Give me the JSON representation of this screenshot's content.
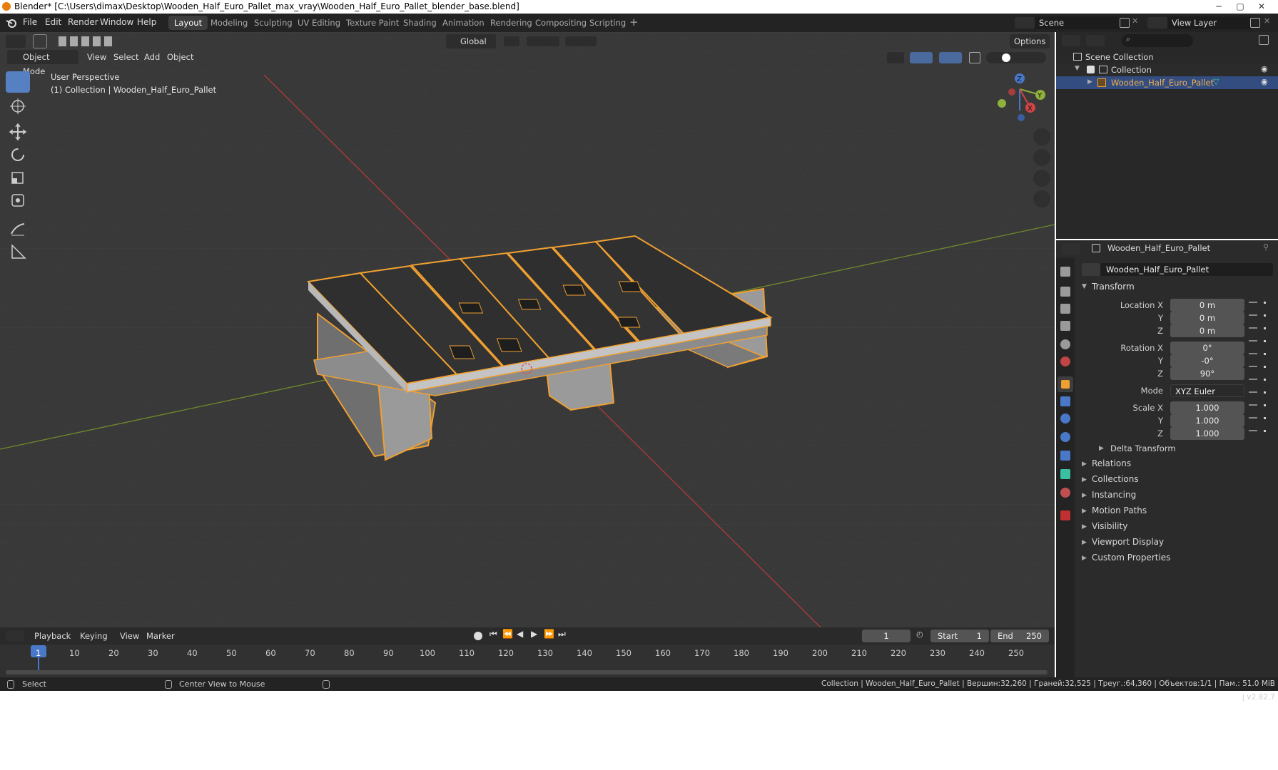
{
  "window": {
    "title": "Blender* [C:\\Users\\dimax\\Desktop\\Wooden_Half_Euro_Pallet_max_vray\\Wooden_Half_Euro_Pallet_blender_base.blend]",
    "min": "─",
    "max": "▢",
    "close": "✕"
  },
  "menu": [
    "File",
    "Edit",
    "Render",
    "Window",
    "Help"
  ],
  "workspaces": [
    "Layout",
    "Modeling",
    "Sculpting",
    "UV Editing",
    "Texture Paint",
    "Shading",
    "Animation",
    "Rendering",
    "Compositing",
    "Scripting"
  ],
  "active_workspace": "Layout",
  "scene": {
    "name": "Scene",
    "view_layer": "View Layer"
  },
  "viewport": {
    "mode": "Object Mode",
    "menus": [
      "View",
      "Select",
      "Add",
      "Object"
    ],
    "orientation": "Global",
    "options": "Options",
    "overlay_line1": "User Perspective",
    "overlay_line2": "(1) Collection | Wooden_Half_Euro_Pallet",
    "gizmo": {
      "x": "X",
      "y": "Y",
      "z": "Z"
    }
  },
  "outliner": {
    "root": "Scene Collection",
    "collection": "Collection",
    "object": "Wooden_Half_Euro_Pallet"
  },
  "properties": {
    "object_header": "Wooden_Half_Euro_Pallet",
    "object_name": "Wooden_Half_Euro_Pallet",
    "transform_title": "Transform",
    "location": {
      "label": "Location X",
      "x": "0 m",
      "y": "0 m",
      "z": "0 m"
    },
    "rotation": {
      "label": "Rotation X",
      "x": "0°",
      "y": "-0°",
      "z": "90°"
    },
    "mode_label": "Mode",
    "mode_value": "XYZ Euler",
    "scale": {
      "label": "Scale X",
      "x": "1.000",
      "y": "1.000",
      "z": "1.000"
    },
    "axis_y": "Y",
    "axis_z": "Z",
    "delta": "Delta Transform",
    "panels": [
      "Relations",
      "Collections",
      "Instancing",
      "Motion Paths",
      "Visibility",
      "Viewport Display",
      "Custom Properties"
    ]
  },
  "timeline": {
    "menus": [
      "Playback",
      "Keying",
      "View",
      "Marker"
    ],
    "current_frame": "1",
    "start_label": "Start",
    "start": "1",
    "end_label": "End",
    "end": "250",
    "ticks": [
      "1",
      "10",
      "20",
      "30",
      "40",
      "50",
      "60",
      "70",
      "80",
      "90",
      "100",
      "110",
      "120",
      "130",
      "140",
      "150",
      "160",
      "170",
      "180",
      "190",
      "200",
      "210",
      "220",
      "230",
      "240",
      "250"
    ]
  },
  "status": {
    "left": "Select",
    "middle": "Center View to Mouse",
    "right": "Collection | Wooden_Half_Euro_Pallet | Вершин:32,260 | Граней:32,525 | Треуг.:64,360 | Объектов:1/1 | Пам.: 51.0 MiB | v2.82.7"
  },
  "colors": {
    "accent": "#5680c2",
    "selection_outline": "#f0a030",
    "viewport_bg": "#393939",
    "x_axis": "#b03a3a",
    "y_axis": "#6f8a2a"
  }
}
